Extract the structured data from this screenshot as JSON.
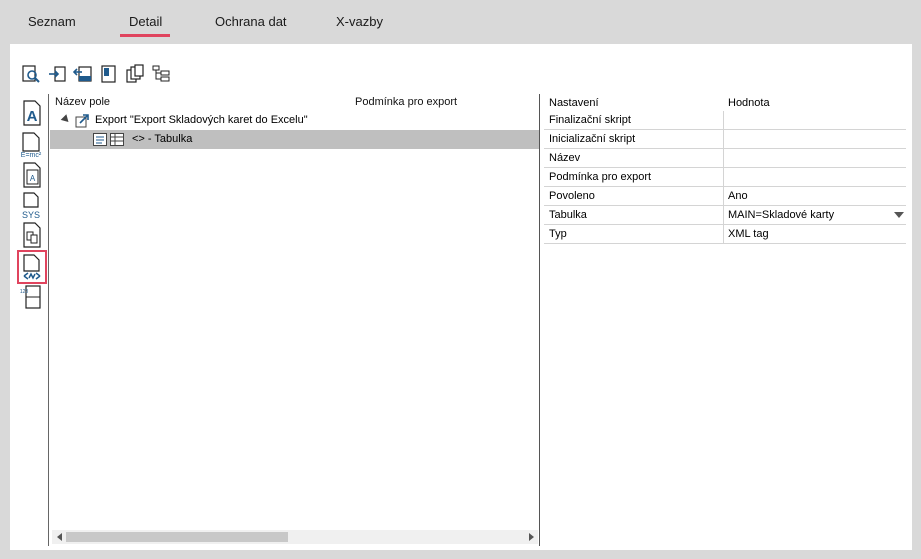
{
  "tabs": [
    {
      "label": "Seznam"
    },
    {
      "label": "Detail"
    },
    {
      "label": "Ochrana dat"
    },
    {
      "label": "X-vazby"
    }
  ],
  "tree": {
    "columns": [
      "Název pole",
      "Podmínka pro export"
    ],
    "rows": [
      {
        "label": "Export \"Export Skladových karet do Excelu\""
      },
      {
        "label": "<> - Tabulka"
      }
    ]
  },
  "properties": {
    "columns": [
      "Nastavení",
      "Hodnota"
    ],
    "rows": [
      {
        "key": "Finalizační skript",
        "value": ""
      },
      {
        "key": "Inicializační skript",
        "value": ""
      },
      {
        "key": "Název",
        "value": ""
      },
      {
        "key": "Podmínka pro export",
        "value": ""
      },
      {
        "key": "Povoleno",
        "value": "Ano"
      },
      {
        "key": "Tabulka",
        "value": "MAIN=Skladové karty"
      },
      {
        "key": "Typ",
        "value": "XML tag"
      }
    ]
  },
  "sidebar_icons": [
    {
      "text": "A"
    },
    {
      "text": "E=mc²"
    },
    {
      "text": "A"
    },
    {
      "text": "SYS"
    },
    {
      "text": ""
    },
    {
      "text": ""
    },
    {
      "text": "123"
    }
  ],
  "colors": {
    "accent": "#e0445e",
    "selection": "#bfbfbf",
    "icon": "#1f5a8c"
  }
}
